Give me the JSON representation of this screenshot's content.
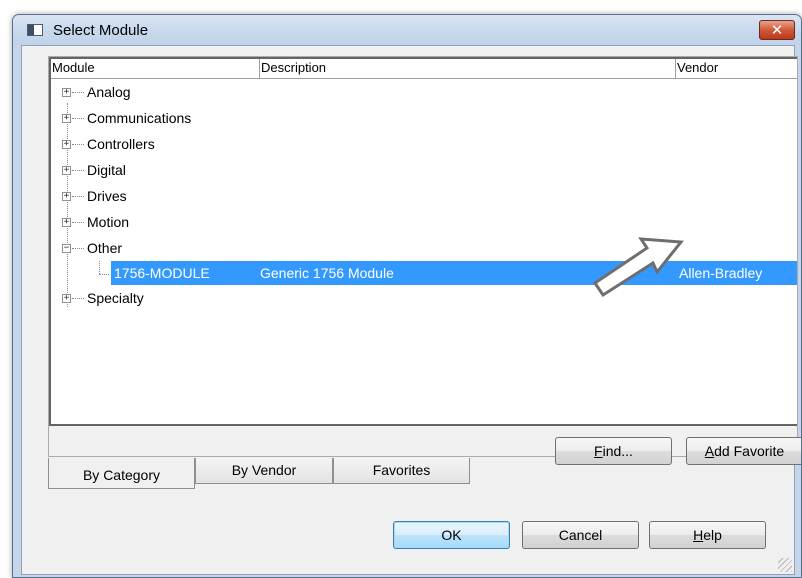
{
  "window": {
    "title": "Select Module",
    "close_glyph": "✕"
  },
  "tree": {
    "columns": {
      "module": "Module",
      "description": "Description",
      "vendor": "Vendor"
    },
    "categories": [
      {
        "label": "Analog",
        "expander": "+"
      },
      {
        "label": "Communications",
        "expander": "+"
      },
      {
        "label": "Controllers",
        "expander": "+"
      },
      {
        "label": "Digital",
        "expander": "+"
      },
      {
        "label": "Drives",
        "expander": "+"
      },
      {
        "label": "Motion",
        "expander": "+"
      },
      {
        "label": "Other",
        "expander": "−"
      },
      {
        "label": "Specialty",
        "expander": "+"
      }
    ],
    "selected_module": {
      "module": "1756-MODULE",
      "description": "Generic 1756 Module",
      "vendor": "Allen-Bradley"
    }
  },
  "buttons": {
    "find": {
      "accel": "F",
      "rest": "ind..."
    },
    "add_favorite": {
      "accel": "A",
      "rest": "dd Favorite"
    },
    "ok": "OK",
    "cancel": "Cancel",
    "help": {
      "accel": "H",
      "rest": "elp"
    }
  },
  "tabs": {
    "by_category": "By Category",
    "by_vendor": "By Vendor",
    "favorites": "Favorites"
  },
  "icons": {
    "window": "window-icon",
    "close": "close-icon",
    "pointer": "arrow-pointer-icon"
  },
  "colors": {
    "selection": "#3399ff",
    "title_bar": "#c9d9ec",
    "close_button": "#c8472a"
  }
}
